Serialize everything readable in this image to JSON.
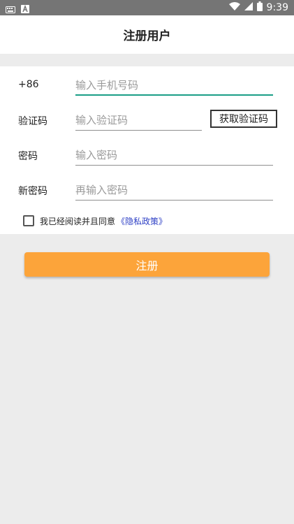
{
  "status_bar": {
    "time": "9:39"
  },
  "header": {
    "title": "注册用户"
  },
  "form": {
    "phone": {
      "label": "+86",
      "placeholder": "输入手机号码"
    },
    "code": {
      "label": "验证码",
      "placeholder": "输入验证码",
      "button": "获取验证码"
    },
    "password": {
      "label": "密码",
      "placeholder": "输入密码"
    },
    "new_password": {
      "label": "新密码",
      "placeholder": "再输入密码"
    },
    "agreement": {
      "text": "我已经阅读并且同意",
      "link": "《隐私政策》"
    }
  },
  "register_button": "注册",
  "colors": {
    "accent": "#fca43a",
    "focus_underline": "#1a9e86",
    "link": "#2d3fc5",
    "status_bar": "#757575"
  }
}
